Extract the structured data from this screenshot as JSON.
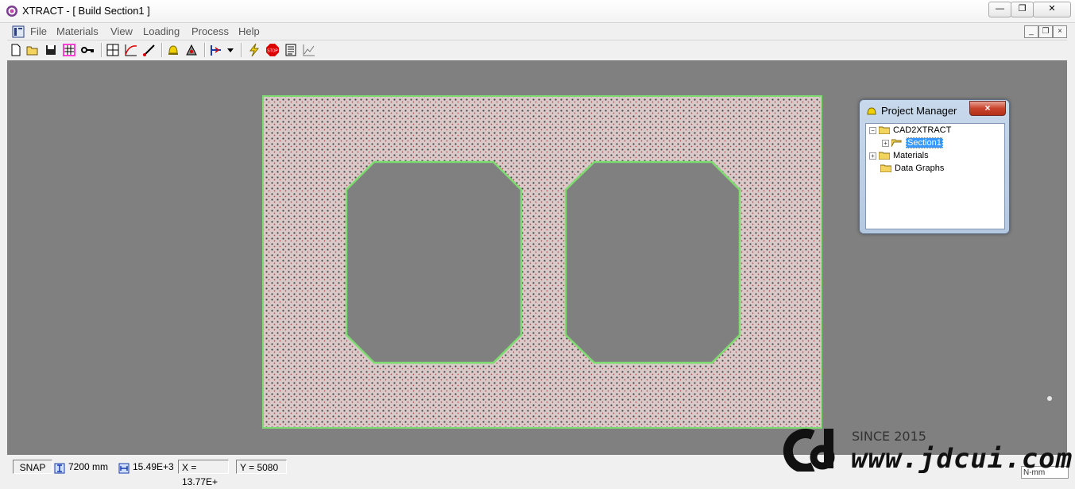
{
  "window": {
    "title": "XTRACT - [ Build Section1 ]"
  },
  "menu": {
    "items": [
      "File",
      "Materials",
      "View",
      "Loading",
      "Process",
      "Help"
    ]
  },
  "toolbar": {
    "icons": [
      "new-file-icon",
      "open-folder-icon",
      "save-icon",
      "grid-select-icon",
      "key-icon",
      "section-grid-icon",
      "moment-curve-icon",
      "line-draw-icon",
      "bell-icon",
      "analysis-icon",
      "axis-icon",
      "dropdown-arrow-icon",
      "lightning-icon",
      "stop-icon",
      "report-icon",
      "chart-icon"
    ]
  },
  "project_manager": {
    "title": "Project Manager",
    "close_label": "×",
    "tree": [
      {
        "label": "CAD2XTRACT",
        "expander": "⊟"
      },
      {
        "label": "Section1",
        "expander": "⊞",
        "selected": true
      },
      {
        "label": "Materials",
        "expander": "⊞"
      },
      {
        "label": "Data Graphs",
        "expander": ""
      }
    ]
  },
  "status": {
    "snap": "SNAP",
    "height": "7200 mm",
    "width": "15.49E+3",
    "x": "X = 13.77E+",
    "y": "Y = 5080",
    "units": "N-mm"
  },
  "watermark": {
    "since": "SINCE 2015",
    "url": "www.jdcui.com"
  },
  "colors": {
    "section_outline": "#7ddc6f",
    "canvas": "#808080"
  }
}
